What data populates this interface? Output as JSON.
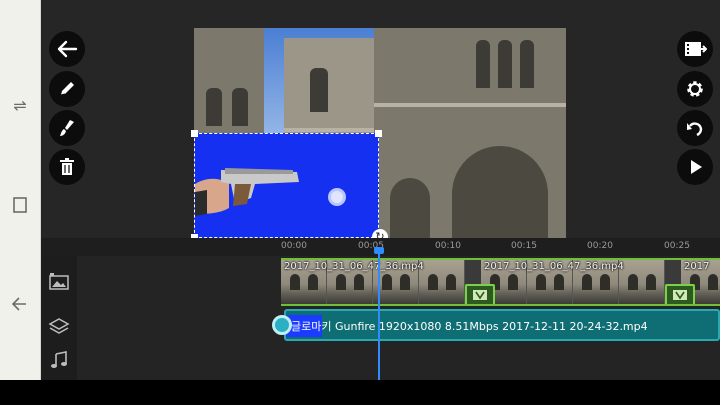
{
  "timeline": {
    "ruler_ticks": [
      "00:00",
      "00:05",
      "00:10",
      "00:15",
      "00:20",
      "00:25"
    ],
    "video_clip_labels": [
      "2017_10_31_06_47_36.mp4",
      "2017_10_31_06_47_36.mp4",
      "2017"
    ],
    "layer_clip_label": "글로마키 Gunfire 1920x1080 8.51Mbps 2017-12-11 20-24-32.mp4"
  },
  "icons": {
    "left_toolbar": [
      "back-arrow-icon",
      "pencil-icon",
      "brush-icon",
      "trash-icon"
    ],
    "right_toolbar": [
      "export-film-icon",
      "gear-icon",
      "undo-icon",
      "play-icon"
    ],
    "track_panel": [
      "media-icon",
      "layers-icon",
      "music-note-icon"
    ],
    "system_nav": [
      "recent-apps-icon",
      "home-icon",
      "back-icon"
    ]
  },
  "colors": {
    "accent_playhead": "#2f8cff",
    "video_track_border": "#6fbf3a",
    "layer_track": "#0f6e73",
    "chroma_blue": "#1530f0"
  }
}
